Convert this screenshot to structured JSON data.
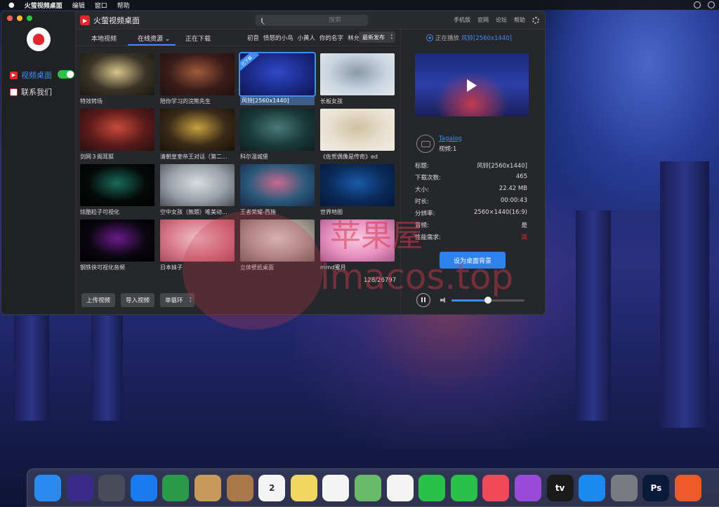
{
  "menubar": {
    "apple": "",
    "items": [
      "火萤视频桌面",
      "编辑",
      "窗口",
      "帮助"
    ]
  },
  "app": {
    "title": "火萤视频桌面",
    "search_placeholder": "搜索",
    "header_links": [
      "手机版",
      "官网",
      "论坛",
      "帮助"
    ]
  },
  "sidebar": {
    "items": [
      {
        "label": "视频桌面",
        "icon": "play-icon",
        "active": true
      },
      {
        "label": "联系我们",
        "icon": "contact-icon",
        "active": false
      }
    ]
  },
  "tabs": [
    {
      "label": "本地视频"
    },
    {
      "label": "在线资源",
      "active": true
    },
    {
      "label": "正在下载"
    }
  ],
  "tags": [
    "初音",
    "愤怒的小鸟",
    "小黄人",
    "你的名字",
    "林允儿"
  ],
  "sort": {
    "selected": "最新发布"
  },
  "videos": [
    {
      "label": "特效转场",
      "colors": [
        "#3a3326",
        "#d8c48a",
        "#1b1712"
      ]
    },
    {
      "label": "陪你学习的浣熊先生",
      "colors": [
        "#3a1c1a",
        "#a05a3a",
        "#201010"
      ]
    },
    {
      "label": "风铃[2560x1440]",
      "colors": [
        "#1b2a88",
        "#3248c8",
        "#0f1650"
      ],
      "selected": true,
      "badge": "已下载"
    },
    {
      "label": "长板女孩",
      "colors": [
        "#c8d4e0",
        "#8a9aa8",
        "#e6e8ea"
      ]
    },
    {
      "label": "剑网３阁耳狐",
      "colors": [
        "#5a1a1a",
        "#c84a3a",
        "#2a1010"
      ]
    },
    {
      "label": "清朝皇室帝王对话（第二...",
      "colors": [
        "#3a2a18",
        "#c8a040",
        "#1a1208"
      ]
    },
    {
      "label": "科尔温城堡",
      "colors": [
        "#1a3a3a",
        "#4a7a78",
        "#0e1e20"
      ]
    },
    {
      "label": "《佐贺偶像是传奇》ed",
      "colors": [
        "#e8e0d0",
        "#d0c0a0",
        "#f0ece4"
      ]
    },
    {
      "label": "炫酷粒子可视化",
      "colors": [
        "#040a08",
        "#1a6a5a",
        "#000000"
      ]
    },
    {
      "label": "空中女孩（無題）唯美动...",
      "colors": [
        "#9aa0a8",
        "#d8dce0",
        "#4a4e56"
      ]
    },
    {
      "label": "王者荣耀-西施",
      "colors": [
        "#2a5a7a",
        "#c86a90",
        "#1a2a4a"
      ]
    },
    {
      "label": "世界地图",
      "colors": [
        "#0a2a5a",
        "#1a5aa8",
        "#061838"
      ]
    },
    {
      "label": "钢铁侠可视化音频",
      "colors": [
        "#0a0610",
        "#6a1a8a",
        "#000000"
      ]
    },
    {
      "label": "日本妹子",
      "colors": [
        "#d87a8a",
        "#f0c0c8",
        "#a84a5a"
      ]
    },
    {
      "label": "立体壁纸桌面",
      "colors": [
        "#a8a29a",
        "#e0dcd4",
        "#6a665e"
      ]
    },
    {
      "label": "mmd蜜月",
      "colors": [
        "#e890c0",
        "#f8c8e0",
        "#a85a8a"
      ]
    }
  ],
  "counter": "128/26797",
  "buttons": {
    "upload": "上传视频",
    "import": "导入视频",
    "loop": "单循环"
  },
  "player": {
    "now_playing_label": "正在播放",
    "now_playing_title": "风铃[2560x1440]",
    "author_name": "Tagalog",
    "author_count": "视频:1",
    "info": [
      {
        "key": "标题:",
        "value": "风铃[2560x1440]"
      },
      {
        "key": "下载次数:",
        "value": "465"
      },
      {
        "key": "大小:",
        "value": "22.42 MB"
      },
      {
        "key": "时长:",
        "value": "00:00:43"
      },
      {
        "key": "分辨率:",
        "value": "2560×1440(16:9)"
      },
      {
        "key": "音频:",
        "value": "是"
      },
      {
        "key": "性能需求:",
        "value": "高",
        "red": true
      }
    ],
    "set_bg_label": "设为桌面背景",
    "volume": 0.5
  },
  "watermark": {
    "cn": "苹果屋",
    "en": "imacos.top"
  },
  "dock": [
    {
      "name": "finder-icon",
      "color": "#2a8af0"
    },
    {
      "name": "siri-icon",
      "color": "#3a2a8a"
    },
    {
      "name": "launchpad-icon",
      "color": "#4a4a5a"
    },
    {
      "name": "safari-icon",
      "color": "#1a7af0"
    },
    {
      "name": "chrome-icon",
      "color": "#2a9a4a"
    },
    {
      "name": "mail-icon",
      "color": "#c89a5a"
    },
    {
      "name": "contacts-icon",
      "color": "#a8784a"
    },
    {
      "name": "calendar-icon",
      "color": "#f4f4f4",
      "text": "2"
    },
    {
      "name": "notes-icon",
      "color": "#f0d860"
    },
    {
      "name": "reminders-icon",
      "color": "#f4f4f4"
    },
    {
      "name": "maps-icon",
      "color": "#6ab86a"
    },
    {
      "name": "photos-icon",
      "color": "#f4f4f4"
    },
    {
      "name": "messages-icon",
      "color": "#2ac04a"
    },
    {
      "name": "facetime-icon",
      "color": "#2ac04a"
    },
    {
      "name": "music-icon",
      "color": "#f04a5a"
    },
    {
      "name": "podcasts-icon",
      "color": "#9a4ad8"
    },
    {
      "name": "apple-tv-icon",
      "color": "#1a1a1a",
      "text": "tv"
    },
    {
      "name": "app-store-icon",
      "color": "#1a8af0"
    },
    {
      "name": "system-preferences-icon",
      "color": "#7a7a82"
    },
    {
      "name": "photoshop-icon",
      "color": "#0a1a3a",
      "text": "Ps"
    },
    {
      "name": "firefly-video-icon",
      "color": "#f05a2a"
    }
  ]
}
